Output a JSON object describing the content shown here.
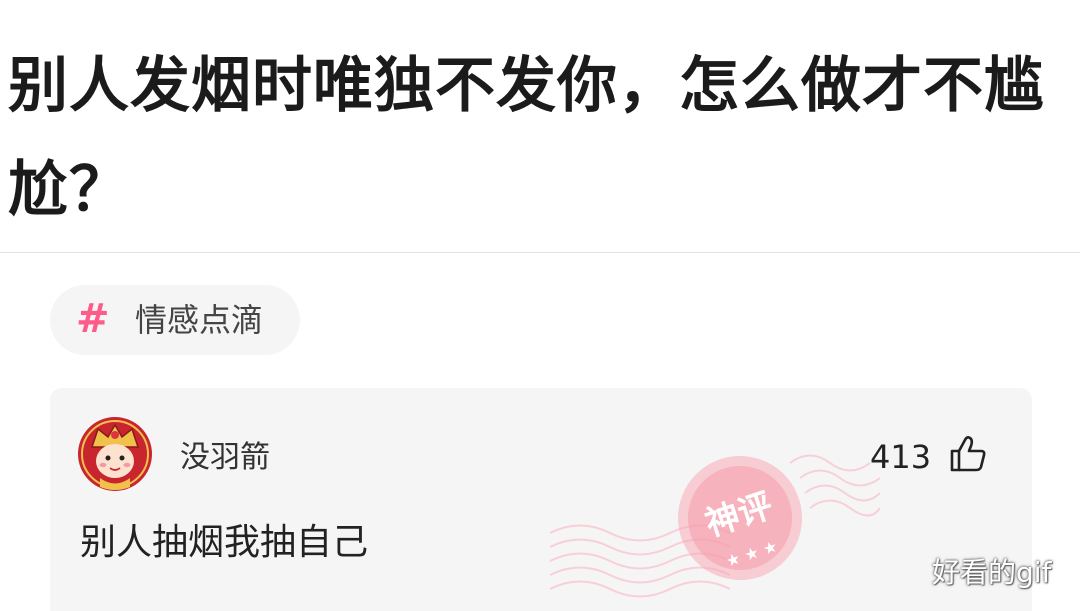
{
  "question": {
    "title": "别人发烟时唯独不发你，怎么做才不尴尬？"
  },
  "topic": {
    "icon": "hashtag-icon",
    "hash_symbol": "#",
    "label": "情感点滴",
    "accent_color": "#ff5b8a"
  },
  "comment": {
    "username": "没羽箭",
    "like_count": "413",
    "text": "别人抽烟我抽自己",
    "badge_text": "神评",
    "badge_color": "#f6a3b0"
  },
  "watermark": "好看的gif"
}
